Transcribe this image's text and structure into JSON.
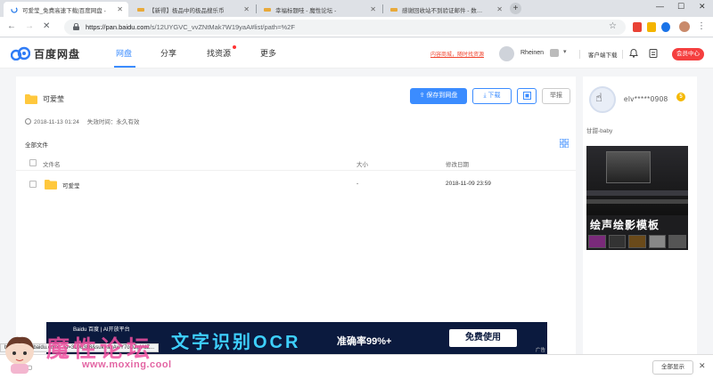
{
  "browser": {
    "tabs": [
      {
        "title": "可爱莹_免费高速下载|百度网盘 -",
        "active": true
      },
      {
        "title": "【新得】极品中的极品搜乐币",
        "active": false
      },
      {
        "title": "幸福标题哇 - 魔性论坛 -",
        "active": false
      },
      {
        "title": "感谢回收站不到验证邮件 - 数…",
        "active": false
      }
    ],
    "new_tab": "+",
    "url_host": "https://pan.baidu.com",
    "url_path": "/s/12UYGVC_vvZNtMak7W19yaA#list/path=%2F",
    "window_min": "—",
    "window_max": "☐",
    "window_close": "✕"
  },
  "app": {
    "logo_text": "百度网盘",
    "nav": [
      {
        "label": "网盘",
        "active": true
      },
      {
        "label": "分享",
        "active": false
      },
      {
        "label": "找资源",
        "active": false
      },
      {
        "label": "更多",
        "active": false
      }
    ],
    "promo": "内容商城，随时找资源",
    "username": "Rheinen",
    "client_download": "客户端下载",
    "vip_button": "会员中心"
  },
  "share": {
    "folder_title": "可爱莹",
    "created": "2018-11-13 01:24",
    "expiry": "失效时间：永久有效",
    "save_button": "保存到网盘",
    "download_button": "下载",
    "report_button": "举报",
    "all_files": "全部文件",
    "columns": {
      "name": "文件名",
      "size": "大小",
      "date": "修改日期"
    },
    "rows": [
      {
        "name": "可爱莹",
        "size": "-",
        "date": "2018-11-09 23:59"
      }
    ]
  },
  "sidebar": {
    "name": "elv*****0908",
    "vip_level": "5",
    "subtitle": "甘甜-baby",
    "ad_title": "绘声绘影模板"
  },
  "banner": {
    "logo": "Baidu 百度 | AI开放平台",
    "headline": "文字识别OCR",
    "rate": "准确率99%+",
    "cta": "免费使用",
    "ad_label": "广告"
  },
  "status_url": "https://www.baidu.com/...id=3106388&suk=aqAwY7oDZgVdZ...",
  "download_bar": {
    "show_all": "全部显示",
    "close": "✕"
  },
  "watermark": {
    "text": "魔性论坛",
    "url": "www.moxing.cool"
  },
  "colors": {
    "accent": "#3b8cff",
    "vip": "#f53f3f",
    "folder": "#ffc83d"
  }
}
